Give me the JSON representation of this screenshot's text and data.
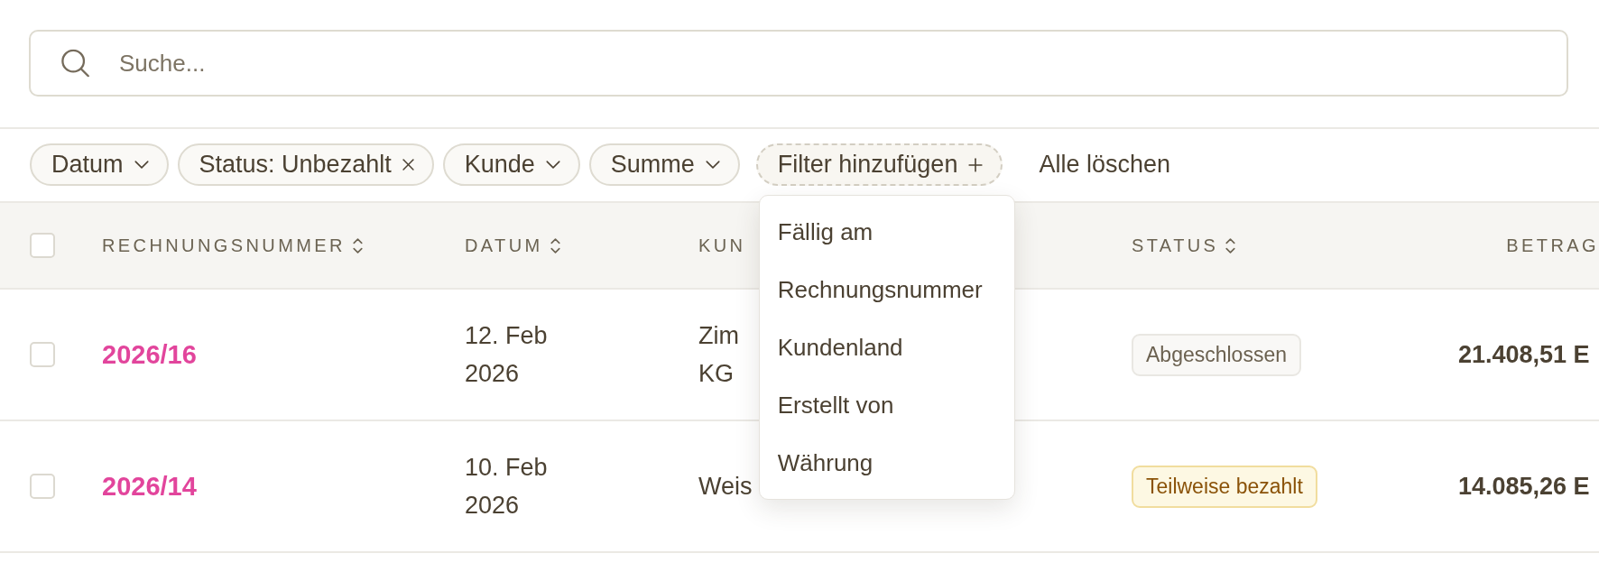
{
  "search": {
    "placeholder": "Suche..."
  },
  "filters": [
    {
      "kind": "dropdown",
      "label": "Datum"
    },
    {
      "kind": "removable",
      "label": "Status: Unbezahlt"
    },
    {
      "kind": "dropdown",
      "label": "Kunde"
    },
    {
      "kind": "dropdown",
      "label": "Summe"
    }
  ],
  "add_filter": {
    "label": "Filter hinzufügen",
    "open": true,
    "menu_items": [
      "Fällig am",
      "Rechnungsnummer",
      "Kundenland",
      "Erstellt von",
      "Währung"
    ]
  },
  "clear_all": "Alle löschen",
  "table": {
    "select_all": {
      "checked": false
    },
    "columns": [
      {
        "label": "RECHNUNGSNUMMER",
        "sort_icon": true
      },
      {
        "label": "DATUM",
        "sort_icon": true
      },
      {
        "label": "KUN",
        "sort_icon": false
      },
      {
        "label": "STATUS",
        "sort_icon": true
      },
      {
        "label": "BETRAG",
        "sort_icon": false
      }
    ],
    "rows": [
      {
        "checked": false,
        "number": "2026/16",
        "date": "12. Feb 2026",
        "customer": [
          "Zim",
          "KG"
        ],
        "status": {
          "kind": "neutral",
          "label": "Abgeschlossen"
        },
        "amount": "21.408,51 E"
      },
      {
        "checked": false,
        "number": "2026/14",
        "date": "10. Feb 2026",
        "customer": [
          "Weis"
        ],
        "status": {
          "kind": "warning",
          "label": "Teilweise bezahlt"
        },
        "amount": "14.085,26 E"
      }
    ]
  }
}
